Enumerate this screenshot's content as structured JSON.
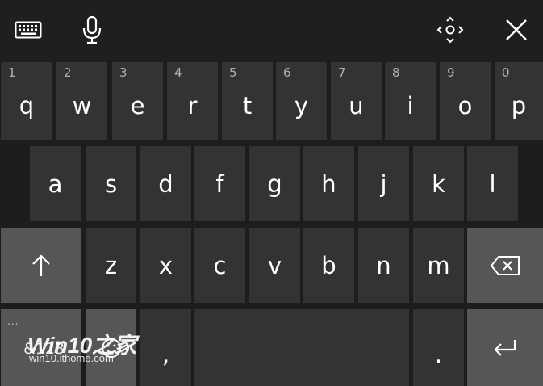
{
  "toolbar": {
    "keyboard_icon": "keyboard-icon",
    "mic_icon": "microphone-icon",
    "move_icon": "move-icon",
    "close_icon": "close-icon"
  },
  "rows": {
    "row1": [
      {
        "label": "q",
        "sub": "1"
      },
      {
        "label": "w",
        "sub": "2"
      },
      {
        "label": "e",
        "sub": "3"
      },
      {
        "label": "r",
        "sub": "4"
      },
      {
        "label": "t",
        "sub": "5"
      },
      {
        "label": "y",
        "sub": "6"
      },
      {
        "label": "u",
        "sub": "7"
      },
      {
        "label": "i",
        "sub": "8"
      },
      {
        "label": "o",
        "sub": "9"
      },
      {
        "label": "p",
        "sub": "0"
      }
    ],
    "row2": [
      "a",
      "s",
      "d",
      "f",
      "g",
      "h",
      "j",
      "k",
      "l"
    ],
    "row3": [
      "z",
      "x",
      "c",
      "v",
      "b",
      "n",
      "m"
    ],
    "row4": {
      "symbols_label": "&123",
      "symbols_dots": "...",
      "comma": ",",
      "period": "."
    }
  },
  "watermark": {
    "title": "Win10之家",
    "url": "win10.ithome.com"
  },
  "colors": {
    "background": "#1b1b1b",
    "key": "#333333",
    "modifier_key": "#565656",
    "text": "#ffffff"
  }
}
